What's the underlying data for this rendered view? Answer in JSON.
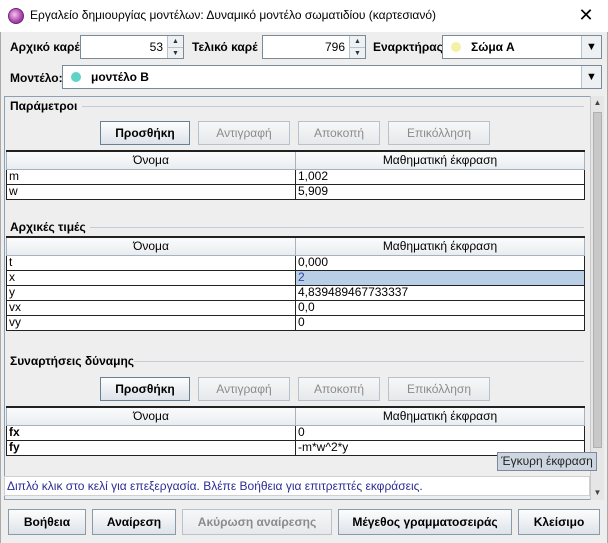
{
  "window": {
    "title": "Εργαλείο δημιουργίας μοντέλων: Δυναμικό μοντέλο σωματιδίου (καρτεσιανό)",
    "close_glyph": "✕",
    "icon": "tracker-app-icon"
  },
  "frames": {
    "start_label": "Αρχικό καρέ",
    "start_value": "53",
    "end_label": "Τελικό καρέ",
    "end_value": "796",
    "booster_label": "Εναρκτήρας",
    "booster_value": "Σώμα Α",
    "booster_color": "#f4f1a6"
  },
  "model": {
    "label": "Μοντέλο:",
    "value": "μοντέλο B",
    "color": "#5fd3c6"
  },
  "parameters": {
    "title": "Παράμετροι",
    "buttons": {
      "add": "Προσθήκη",
      "copy": "Αντιγραφή",
      "cut": "Αποκοπή",
      "paste": "Επικόλληση"
    },
    "columns": [
      "Όνομα",
      "Μαθηματική έκφραση"
    ],
    "rows": [
      {
        "name": "m",
        "expr": "1,002"
      },
      {
        "name": "w",
        "expr": "5,909"
      }
    ]
  },
  "initial_values": {
    "title": "Αρχικές τιμές",
    "columns": [
      "Όνομα",
      "Μαθηματική έκφραση"
    ],
    "rows": [
      {
        "name": "t",
        "expr": "0,000"
      },
      {
        "name": "x",
        "expr": "2"
      },
      {
        "name": "y",
        "expr": "4,839489467733337"
      },
      {
        "name": "vx",
        "expr": "0,0"
      },
      {
        "name": "vy",
        "expr": "0"
      }
    ]
  },
  "force_functions": {
    "title": "Συναρτήσεις δύναμης",
    "buttons": {
      "add": "Προσθήκη",
      "copy": "Αντιγραφή",
      "cut": "Αποκοπή",
      "paste": "Επικόλληση"
    },
    "columns": [
      "Όνομα",
      "Μαθηματική έκφραση"
    ],
    "rows": [
      {
        "name": "fx",
        "expr": "0"
      },
      {
        "name": "fy",
        "expr": "-m*w^2*y"
      }
    ]
  },
  "tooltip": "Έγκυρη έκφραση",
  "status": "Διπλό κλικ στο κελί για επεξεργασία. Βλέπε Βοήθεια για επιτρεπτές εκφράσεις.",
  "footer": {
    "help": "Βοήθεια",
    "undo": "Αναίρεση",
    "redo": "Ακύρωση αναίρεσης",
    "font_size": "Μέγεθος γραμματοσειράς",
    "close": "Κλείσιμο"
  }
}
